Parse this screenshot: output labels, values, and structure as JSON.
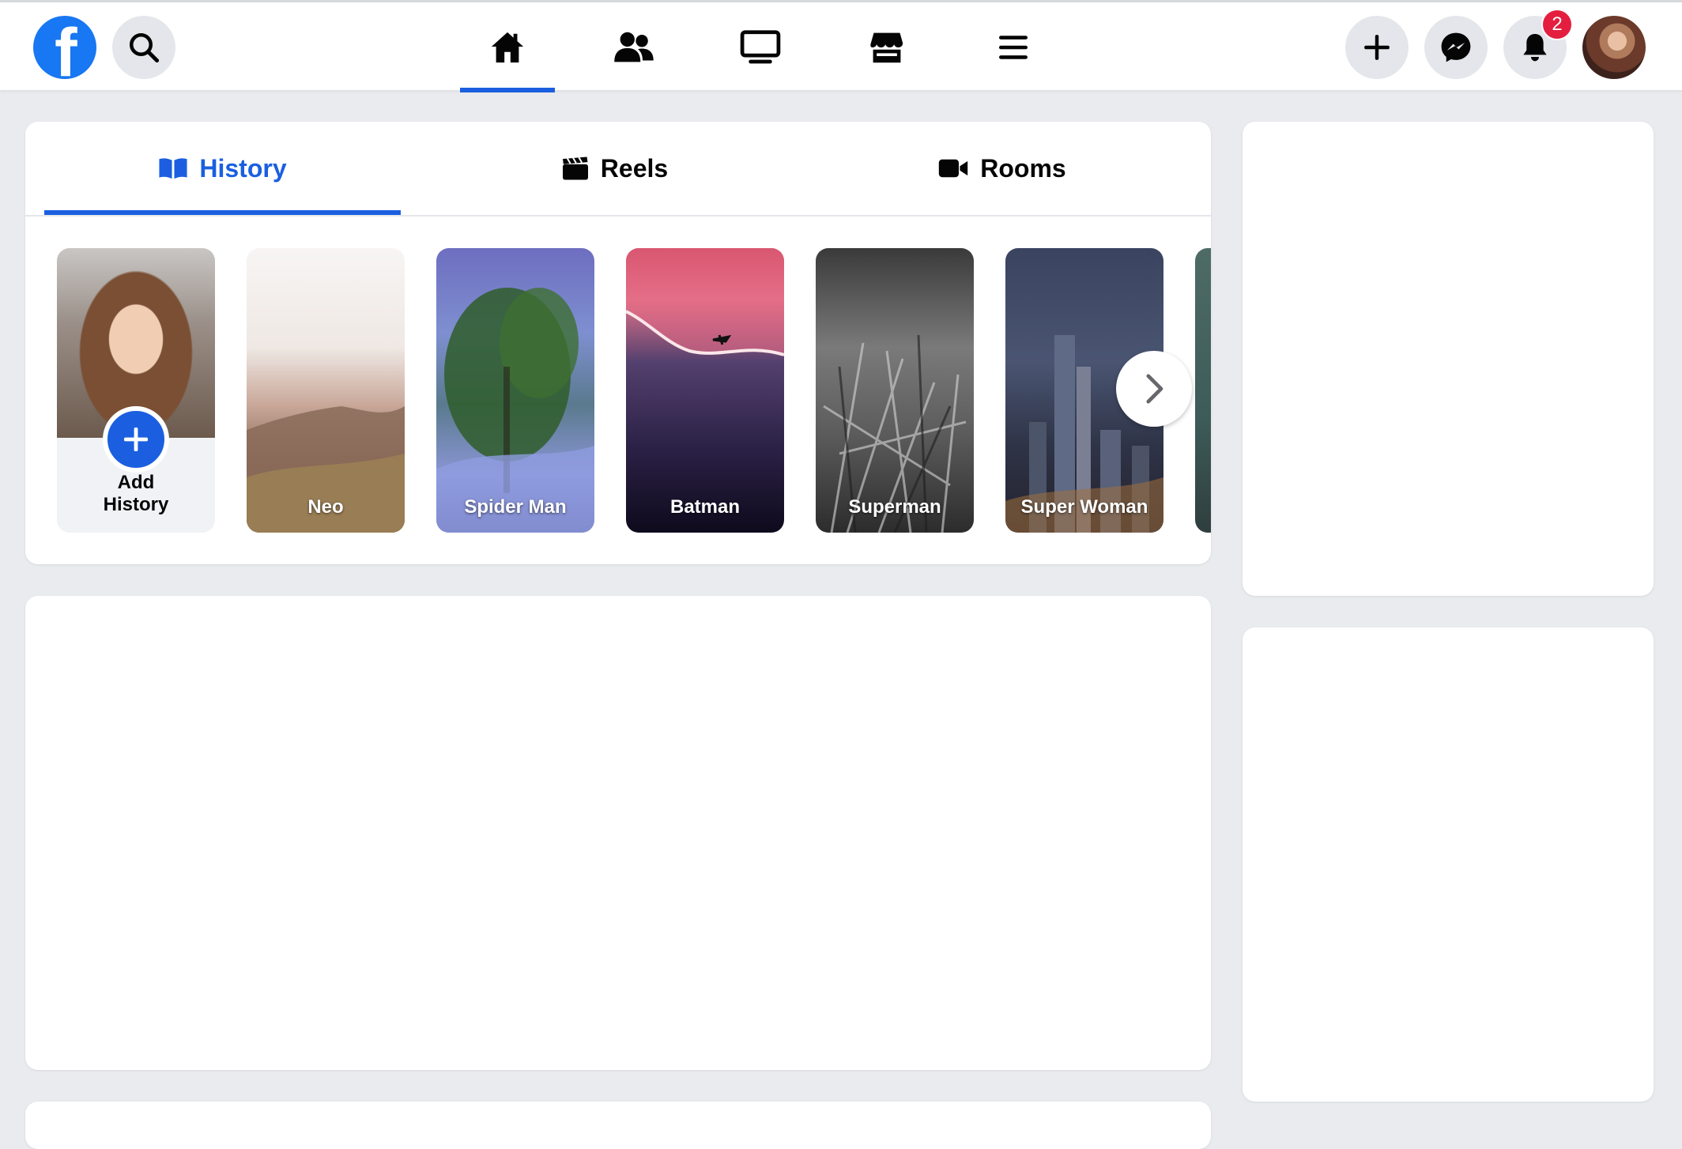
{
  "topbar": {
    "logo_letter": "f",
    "notifications_count": "2",
    "nav": [
      "home-icon",
      "friends-icon",
      "watch-icon",
      "marketplace-icon",
      "menu-icon"
    ],
    "active_nav": "home"
  },
  "tabs": [
    {
      "label": "History",
      "icon": "book-icon",
      "active": true
    },
    {
      "label": "Reels",
      "icon": "clapperboard-icon",
      "active": false
    },
    {
      "label": "Rooms",
      "icon": "video-camera-icon",
      "active": false
    }
  ],
  "stories": {
    "add_label_line1": "Add",
    "add_label_line2": "History",
    "items": [
      "Neo",
      "Spider Man",
      "Batman",
      "Superman",
      "Super Woman"
    ]
  },
  "colors": {
    "accent": "#1b5fe0",
    "brand": "#1877f2",
    "badge": "#e41e3f",
    "background": "#e9ebee"
  }
}
